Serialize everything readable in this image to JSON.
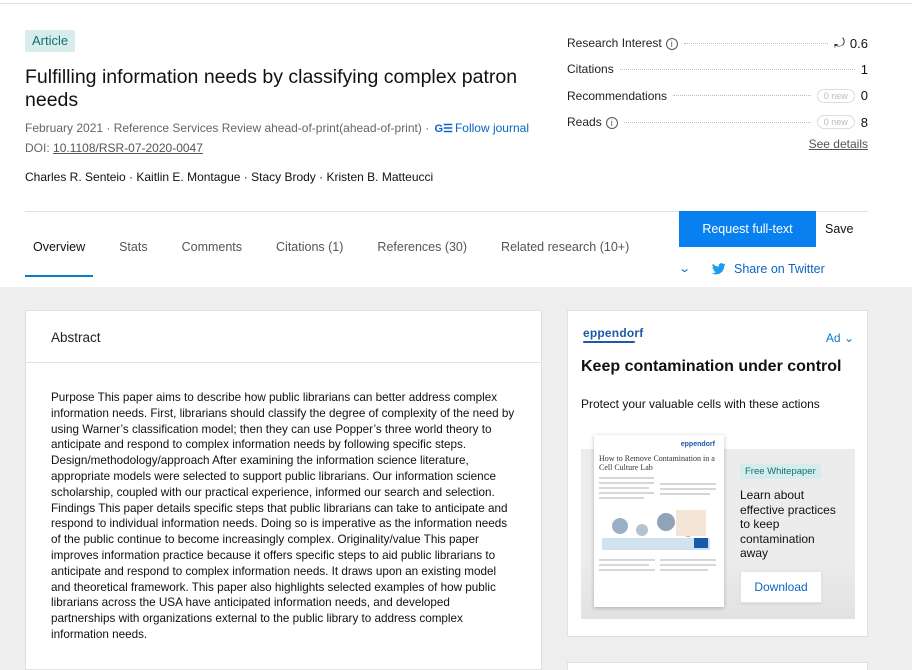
{
  "article": {
    "badge": "Article",
    "title": "Fulfilling information needs by classifying complex patron needs",
    "date_journal": "February 2021 · Reference Services Review ahead-of-print(ahead-of-print) ·",
    "follow_label": "Follow journal",
    "doi_prefix": "DOI:",
    "doi": "10.1108/RSR-07-2020-0047",
    "authors": "Charles R. Senteio · Kaitlin E. Montague · Stacy Brody · Kristen B. Matteucci"
  },
  "stats": {
    "research_interest": {
      "label": "Research Interest",
      "value": "0.6"
    },
    "citations": {
      "label": "Citations",
      "value": "1"
    },
    "recommendations": {
      "label": "Recommendations",
      "new": "0 new",
      "value": "0"
    },
    "reads": {
      "label": "Reads",
      "new": "0 new",
      "value": "8"
    },
    "see_details": "See details"
  },
  "actions": {
    "request_fulltext": "Request full-text",
    "save": "Save",
    "share_twitter": "Share on Twitter"
  },
  "tabs": [
    {
      "label": "Overview"
    },
    {
      "label": "Stats"
    },
    {
      "label": "Comments"
    },
    {
      "label": "Citations (1)"
    },
    {
      "label": "References (30)"
    },
    {
      "label": "Related research (10+)"
    }
  ],
  "abstract": {
    "heading": "Abstract",
    "text": "Purpose This paper aims to describe how public librarians can better address complex information needs. First, librarians should classify the degree of complexity of the need by using Warner’s classification model; then they can use Popper’s three world theory to anticipate and respond to complex information needs by following specific steps. Design/methodology/approach After examining the information science literature, appropriate models were selected to support public librarians. Our information science scholarship, coupled with our practical experience, informed our search and selection. Findings This paper details specific steps that public librarians can take to anticipate and respond to individual information needs. Doing so is imperative as the information needs of the public continue to become increasingly complex. Originality/value This paper improves information practice because it offers specific steps to aid public librarians to anticipate and respond to complex information needs. It draws upon an existing model and theoretical framework. This paper also highlights selected examples of how public librarians across the USA have anticipated information needs, and developed partnerships with organizations external to the public library to address complex information needs."
  },
  "ad": {
    "brand": "eppendorf",
    "label": "Ad",
    "title": "Keep contamination under control",
    "subtitle": "Protect your valuable cells with these actions",
    "paper_brand": "eppendorf",
    "paper_title": "How to Remove Contamination in a Cell Culture Lab",
    "badge": "Free Whitepaper",
    "text": "Learn about effective practices to keep contamination away",
    "button": "Download"
  },
  "colors": {
    "accent": "#0880f0",
    "link": "#0a66c2",
    "badge_bg": "#d8ecec",
    "badge_text": "#10706f",
    "page_bg": "#eeeeee"
  }
}
